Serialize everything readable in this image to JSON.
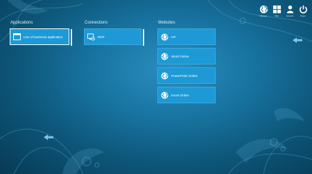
{
  "topbar": {
    "items": [
      {
        "label": "Browse",
        "icon": "globe-icon"
      },
      {
        "label": "Tiles",
        "icon": "tiles-icon"
      },
      {
        "label": "Account",
        "icon": "user-icon"
      },
      {
        "label": "Power",
        "icon": "power-icon"
      }
    ]
  },
  "sections": {
    "applications": {
      "title": "Applications",
      "tiles": [
        {
          "label": "Line of business application",
          "icon": "window-icon"
        }
      ]
    },
    "connections": {
      "title": "Connections",
      "tiles": [
        {
          "label": "RDP",
          "icon": "remote-desktop-icon"
        }
      ]
    },
    "websites": {
      "title": "Websites",
      "tiles": [
        {
          "label": "HP",
          "icon": "web-globe-icon"
        },
        {
          "label": "Word Online",
          "icon": "web-globe-icon"
        },
        {
          "label": "PowerPoint Online",
          "icon": "web-globe-icon"
        },
        {
          "label": "Excel Online",
          "icon": "web-globe-icon"
        }
      ]
    }
  },
  "colors": {
    "tile": "#1d9ad6",
    "background": "#17729f",
    "accent": "#ffffff"
  }
}
